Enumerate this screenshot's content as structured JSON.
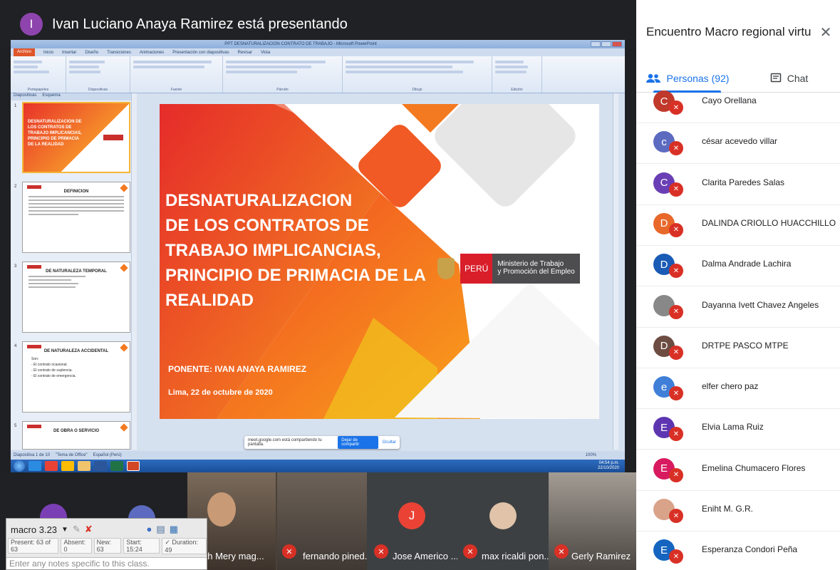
{
  "presenter": {
    "initial": "I",
    "label": "Ivan Luciano Anaya Ramirez está presentando"
  },
  "ppt": {
    "window_title": "PPT DESNATURALIZACION CONTRATO DE TRABAJO - Microsoft PowerPoint",
    "tabs": [
      "Archivo",
      "Inicio",
      "Insertar",
      "Diseño",
      "Transiciones",
      "Animaciones",
      "Presentación con diapositivas",
      "Revisar",
      "Vista"
    ],
    "ribbon_groups": [
      "Portapapeles",
      "Diapositivas",
      "Fuente",
      "Párrafo",
      "Dibujo",
      "Edición"
    ],
    "pane_tabs": [
      "Diapositivas",
      "Esquema"
    ],
    "status": [
      "Diapositiva 1 de 10",
      "\"Tema de Office\"",
      "Español (Perú)"
    ],
    "zoom": "100%",
    "thumbnails": [
      {
        "num": "1",
        "title": "DESNATURALIZACION DE LOS CONTRATOS DE TRABAJO IMPLICANCIAS, PRINCIPIO DE PRIMACIA DE LA REALIDAD"
      },
      {
        "num": "2",
        "title": "DEFINICION"
      },
      {
        "num": "3",
        "title": "DE NATURALEZA TEMPORAL"
      },
      {
        "num": "4",
        "title": "DE NATURALEZA ACCIDENTAL"
      },
      {
        "num": "5",
        "title": "DE OBRA O SERVICIO"
      }
    ],
    "thumb4_lines": [
      "Son:",
      "- El contrato ocasional.",
      "- El contrato de suplencia.",
      "- El contrato de emergencia."
    ],
    "slide": {
      "title_lines": [
        "DESNATURALIZACION",
        "DE LOS  CONTRATOS DE",
        "TRABAJO IMPLICANCIAS,",
        "PRINCIPIO DE PRIMACIA DE LA",
        "REALIDAD"
      ],
      "ponente": "PONENTE: IVAN ANAYA RAMIREZ",
      "date": "Lima, 22 de octubre de 2020",
      "logo_peru": "PERÚ",
      "logo_ministerio_1": "Ministerio de Trabajo",
      "logo_ministerio_2": "y Promoción del Empleo"
    },
    "sharing_text": "meet.google.com está compartiendo tu pantalla.",
    "stop_sharing": "Dejar de compartir",
    "hide": "Ocultar",
    "clock_time": "04:54 p.m.",
    "clock_date": "22/10/2020"
  },
  "tool": {
    "name": "macro 3.23",
    "present": "Present: 63 of 63",
    "absent": "Absent: 0",
    "new": "New: 63",
    "start": "Start: 15:24",
    "duration": "✓ Duration: 49",
    "notes_placeholder": "Enter any notes specific to this class."
  },
  "tiles": [
    {
      "name": "Ruth Mery mag..."
    },
    {
      "name": "fernando pined..."
    },
    {
      "name": "Jose Americo ...",
      "initial": "J"
    },
    {
      "name": "max ricaldi pon..."
    },
    {
      "name": "Gerly Ramirez"
    }
  ],
  "panel": {
    "title": "Encuentro Macro regional virtual ...",
    "tab_people": "Personas (92)",
    "tab_chat": "Chat",
    "participants": [
      {
        "initial": "C",
        "name": "Cayo Orellana",
        "color": "#c0392b"
      },
      {
        "initial": "c",
        "name": "césar acevedo villar",
        "color": "#5c6bc0"
      },
      {
        "initial": "C",
        "name": "Clarita Paredes Salas",
        "color": "#6a3fb5"
      },
      {
        "initial": "D",
        "name": "DALINDA CRIOLLO HUACCHILLO",
        "color": "#e8682a"
      },
      {
        "initial": "D",
        "name": "Dalma Andrade Lachira",
        "color": "#1a5bb5"
      },
      {
        "initial": "",
        "name": "Dayanna Ivett Chavez Angeles",
        "color": "#888888"
      },
      {
        "initial": "D",
        "name": "DRTPE PASCO MTPE",
        "color": "#6d4c41"
      },
      {
        "initial": "e",
        "name": "elfer chero paz",
        "color": "#3f7fd8"
      },
      {
        "initial": "E",
        "name": "Elvia Lama Ruiz",
        "color": "#5e35b1"
      },
      {
        "initial": "E",
        "name": "Emelina Chumacero Flores",
        "color": "#d81b60"
      },
      {
        "initial": "",
        "name": "Eniht M. G.R.",
        "color": "#d9a38a"
      },
      {
        "initial": "E",
        "name": "Esperanza Condori Peña",
        "color": "#1565c0"
      }
    ]
  }
}
